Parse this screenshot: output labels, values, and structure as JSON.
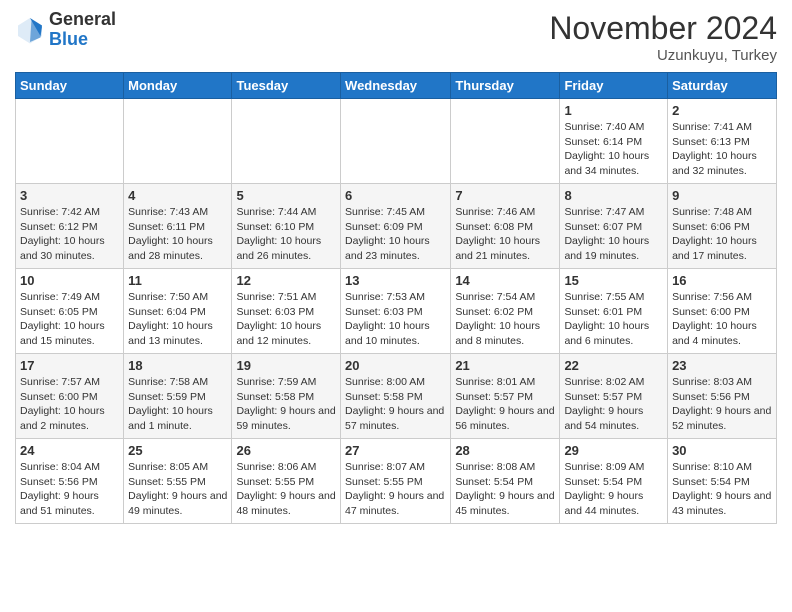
{
  "header": {
    "logo_line1": "General",
    "logo_line2": "Blue",
    "month": "November 2024",
    "location": "Uzunkuyu, Turkey"
  },
  "weekdays": [
    "Sunday",
    "Monday",
    "Tuesday",
    "Wednesday",
    "Thursday",
    "Friday",
    "Saturday"
  ],
  "weeks": [
    [
      {
        "day": "",
        "info": ""
      },
      {
        "day": "",
        "info": ""
      },
      {
        "day": "",
        "info": ""
      },
      {
        "day": "",
        "info": ""
      },
      {
        "day": "",
        "info": ""
      },
      {
        "day": "1",
        "info": "Sunrise: 7:40 AM\nSunset: 6:14 PM\nDaylight: 10 hours\nand 34 minutes."
      },
      {
        "day": "2",
        "info": "Sunrise: 7:41 AM\nSunset: 6:13 PM\nDaylight: 10 hours\nand 32 minutes."
      }
    ],
    [
      {
        "day": "3",
        "info": "Sunrise: 7:42 AM\nSunset: 6:12 PM\nDaylight: 10 hours\nand 30 minutes."
      },
      {
        "day": "4",
        "info": "Sunrise: 7:43 AM\nSunset: 6:11 PM\nDaylight: 10 hours\nand 28 minutes."
      },
      {
        "day": "5",
        "info": "Sunrise: 7:44 AM\nSunset: 6:10 PM\nDaylight: 10 hours\nand 26 minutes."
      },
      {
        "day": "6",
        "info": "Sunrise: 7:45 AM\nSunset: 6:09 PM\nDaylight: 10 hours\nand 23 minutes."
      },
      {
        "day": "7",
        "info": "Sunrise: 7:46 AM\nSunset: 6:08 PM\nDaylight: 10 hours\nand 21 minutes."
      },
      {
        "day": "8",
        "info": "Sunrise: 7:47 AM\nSunset: 6:07 PM\nDaylight: 10 hours\nand 19 minutes."
      },
      {
        "day": "9",
        "info": "Sunrise: 7:48 AM\nSunset: 6:06 PM\nDaylight: 10 hours\nand 17 minutes."
      }
    ],
    [
      {
        "day": "10",
        "info": "Sunrise: 7:49 AM\nSunset: 6:05 PM\nDaylight: 10 hours\nand 15 minutes."
      },
      {
        "day": "11",
        "info": "Sunrise: 7:50 AM\nSunset: 6:04 PM\nDaylight: 10 hours\nand 13 minutes."
      },
      {
        "day": "12",
        "info": "Sunrise: 7:51 AM\nSunset: 6:03 PM\nDaylight: 10 hours\nand 12 minutes."
      },
      {
        "day": "13",
        "info": "Sunrise: 7:53 AM\nSunset: 6:03 PM\nDaylight: 10 hours\nand 10 minutes."
      },
      {
        "day": "14",
        "info": "Sunrise: 7:54 AM\nSunset: 6:02 PM\nDaylight: 10 hours\nand 8 minutes."
      },
      {
        "day": "15",
        "info": "Sunrise: 7:55 AM\nSunset: 6:01 PM\nDaylight: 10 hours\nand 6 minutes."
      },
      {
        "day": "16",
        "info": "Sunrise: 7:56 AM\nSunset: 6:00 PM\nDaylight: 10 hours\nand 4 minutes."
      }
    ],
    [
      {
        "day": "17",
        "info": "Sunrise: 7:57 AM\nSunset: 6:00 PM\nDaylight: 10 hours\nand 2 minutes."
      },
      {
        "day": "18",
        "info": "Sunrise: 7:58 AM\nSunset: 5:59 PM\nDaylight: 10 hours\nand 1 minute."
      },
      {
        "day": "19",
        "info": "Sunrise: 7:59 AM\nSunset: 5:58 PM\nDaylight: 9 hours\nand 59 minutes."
      },
      {
        "day": "20",
        "info": "Sunrise: 8:00 AM\nSunset: 5:58 PM\nDaylight: 9 hours\nand 57 minutes."
      },
      {
        "day": "21",
        "info": "Sunrise: 8:01 AM\nSunset: 5:57 PM\nDaylight: 9 hours\nand 56 minutes."
      },
      {
        "day": "22",
        "info": "Sunrise: 8:02 AM\nSunset: 5:57 PM\nDaylight: 9 hours\nand 54 minutes."
      },
      {
        "day": "23",
        "info": "Sunrise: 8:03 AM\nSunset: 5:56 PM\nDaylight: 9 hours\nand 52 minutes."
      }
    ],
    [
      {
        "day": "24",
        "info": "Sunrise: 8:04 AM\nSunset: 5:56 PM\nDaylight: 9 hours\nand 51 minutes."
      },
      {
        "day": "25",
        "info": "Sunrise: 8:05 AM\nSunset: 5:55 PM\nDaylight: 9 hours\nand 49 minutes."
      },
      {
        "day": "26",
        "info": "Sunrise: 8:06 AM\nSunset: 5:55 PM\nDaylight: 9 hours\nand 48 minutes."
      },
      {
        "day": "27",
        "info": "Sunrise: 8:07 AM\nSunset: 5:55 PM\nDaylight: 9 hours\nand 47 minutes."
      },
      {
        "day": "28",
        "info": "Sunrise: 8:08 AM\nSunset: 5:54 PM\nDaylight: 9 hours\nand 45 minutes."
      },
      {
        "day": "29",
        "info": "Sunrise: 8:09 AM\nSunset: 5:54 PM\nDaylight: 9 hours\nand 44 minutes."
      },
      {
        "day": "30",
        "info": "Sunrise: 8:10 AM\nSunset: 5:54 PM\nDaylight: 9 hours\nand 43 minutes."
      }
    ]
  ]
}
